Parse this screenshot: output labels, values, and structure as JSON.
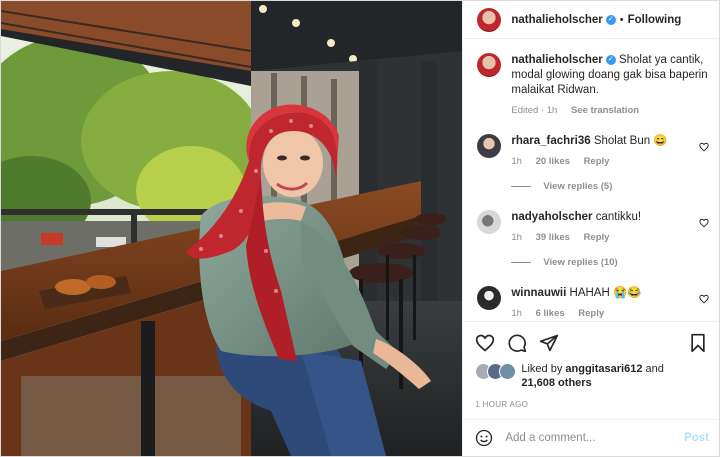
{
  "post": {
    "author": "nathalieholscher",
    "follow_label": "Following",
    "caption": "Sholat ya cantik, modal glowing doang gak bisa baperin malaikat Ridwan.",
    "edited": "Edited · 1h",
    "see_translation": "See translation"
  },
  "comments": [
    {
      "user": "rhara_fachri36",
      "text": "Sholat Bun 😄",
      "time": "1h",
      "likes": "20 likes",
      "reply": "Reply",
      "view_replies": "View replies (5)"
    },
    {
      "user": "nadyaholscher",
      "text": "cantikku!",
      "time": "1h",
      "likes": "39 likes",
      "reply": "Reply",
      "view_replies": "View replies (10)"
    },
    {
      "user": "winnauwii",
      "text": "HAHAH 😭😂",
      "time": "1h",
      "likes": "6 likes",
      "reply": "Reply"
    }
  ],
  "likes": {
    "prefix": "Liked by",
    "user": "anggitasari612",
    "and": "and",
    "others": "21,608 others"
  },
  "time_ago": "1 HOUR AGO",
  "add_comment": {
    "placeholder": "Add a comment...",
    "post_label": "Post"
  },
  "colors": {
    "accent_blue": "#3897f0",
    "post_disabled": "#b2dffc",
    "muted": "#8e8e8e"
  }
}
